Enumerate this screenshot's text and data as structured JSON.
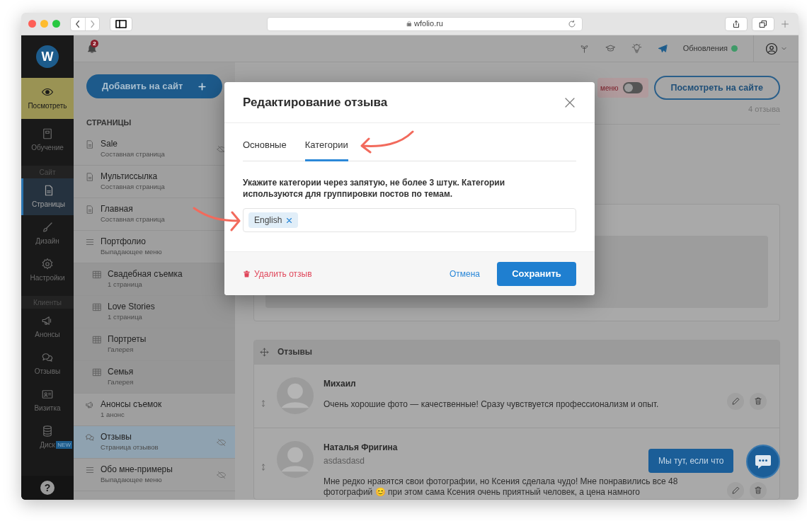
{
  "browser": {
    "url": "wfolio.ru"
  },
  "topbar": {
    "notification_count": "2",
    "updates_label": "Обновления"
  },
  "rail": {
    "logo": "W",
    "items": [
      {
        "kind": "featured",
        "label": "Посмотреть"
      },
      {
        "kind": "item",
        "label": "Обучение",
        "selected": false
      },
      {
        "kind": "section",
        "label": "Сайт"
      },
      {
        "kind": "item",
        "label": "Страницы",
        "selected": true
      },
      {
        "kind": "item",
        "label": "Дизайн",
        "selected": false
      },
      {
        "kind": "item",
        "label": "Настройки",
        "selected": false
      },
      {
        "kind": "section",
        "label": "Клиенты"
      },
      {
        "kind": "item",
        "label": "Анонсы",
        "selected": false
      },
      {
        "kind": "item",
        "label": "Отзывы",
        "selected": false
      },
      {
        "kind": "item",
        "label": "Визитка",
        "selected": false
      },
      {
        "kind": "item",
        "label": "Диск",
        "badge": "NEW",
        "selected": false
      },
      {
        "kind": "help",
        "label": "?"
      }
    ]
  },
  "pages": {
    "add_button": "Добавить на сайт",
    "heading": "СТРАНИЦЫ",
    "items": [
      {
        "title": "Sale",
        "subtitle": "Составная страница",
        "kind": "page",
        "hidden": true,
        "selected": false
      },
      {
        "title": "Мультиссылка",
        "subtitle": "Составная страница",
        "kind": "page",
        "hidden": false,
        "selected": false
      },
      {
        "title": "Главная",
        "subtitle": "Составная страница",
        "kind": "page",
        "hidden": false,
        "selected": false
      },
      {
        "title": "Портфолио",
        "subtitle": "Выпадающее меню",
        "kind": "dropdown",
        "hidden": false,
        "selected": false,
        "children": [
          {
            "title": "Свадебная съемка",
            "subtitle": "1 страница",
            "kind": "gallery",
            "hidden": false,
            "selected": false
          },
          {
            "title": "Love Stories",
            "subtitle": "1 страница",
            "kind": "gallery",
            "hidden": false,
            "selected": false
          },
          {
            "title": "Портреты",
            "subtitle": "Галерея",
            "kind": "gallery",
            "hidden": false,
            "selected": false
          },
          {
            "title": "Семья",
            "subtitle": "Галерея",
            "kind": "gallery",
            "hidden": false,
            "selected": false
          }
        ]
      },
      {
        "title": "Анонсы съемок",
        "subtitle": "1 анонс",
        "kind": "announcements",
        "hidden": false,
        "selected": false
      },
      {
        "title": "Отзывы",
        "subtitle": "Страница отзывов",
        "kind": "reviews",
        "hidden": true,
        "selected": true
      },
      {
        "title": "Обо мне-примеры",
        "subtitle": "Выпадающее меню",
        "kind": "dropdown",
        "hidden": true,
        "selected": false
      }
    ]
  },
  "main": {
    "menu_toggle": {
      "label": "меню",
      "on": false
    },
    "view_button": "Посмотреть на сайте",
    "count": "4 отзыва",
    "reviews": {
      "title": "Отзывы",
      "items": [
        {
          "name": "Михаил",
          "text": "Очень хорошие фото — качественные! Сразу чувствуется профессионализм и опыт."
        },
        {
          "name": "Наталья Фригина",
          "subtitle": "asdasdasd",
          "text": "Мне редко нравятся свои фотографии, но Ксения сделала чудо! Мне понравились все 48 фотографий 😊 при этом сама Ксения очень приятный человек, а цена намного"
        }
      ]
    }
  },
  "chat": {
    "label": "Мы тут, если что"
  },
  "modal": {
    "title": "Редактирование отзыва",
    "tabs": [
      {
        "label": "Основные",
        "selected": false
      },
      {
        "label": "Категории",
        "selected": true
      }
    ],
    "hint": "Укажите категории через запятую, не более 3 штук. Категории используются для группировки постов по темам.",
    "tags": [
      {
        "label": "English"
      }
    ],
    "delete_label": "Удалить отзыв",
    "cancel_label": "Отмена",
    "save_label": "Сохранить"
  }
}
